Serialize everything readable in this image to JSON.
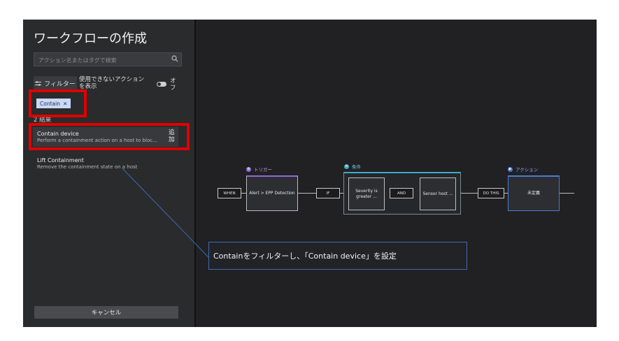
{
  "panel": {
    "title": "ワークフローの作成",
    "search_placeholder": "アクション名またはタグで検索",
    "filter_label": "フィルター",
    "unavailable_toggle_label": "使用できないアクションを表示",
    "toggle_state": "オフ",
    "chip_label": "Contain",
    "results_count": "2 結果",
    "results": [
      {
        "name": "Contain device",
        "description": "Perform a containment action on a host to bloc..."
      },
      {
        "name": "Lift Containment",
        "description": "Remove the containment state on a host"
      }
    ],
    "add_label": "追加",
    "cancel_label": "キャンセル"
  },
  "diagram": {
    "trigger_header": "トリガー",
    "condition_header": "条件",
    "action_header": "アクション",
    "when_label": "WHEN",
    "trigger_node": "Alert > EPP Detection",
    "if_label": "IF",
    "condition1": "Severity is greater ...",
    "and_label": "AND",
    "condition2": "Sensor host ...",
    "do_this_label": "DO THIS",
    "action_node": "未定義"
  },
  "annotation": {
    "callout_text": "Containをフィルターし、「Contain device」を設定"
  },
  "colors": {
    "trigger_accent": "#8e6ad8",
    "condition_accent": "#3fa9c9",
    "action_accent": "#4a7bd0",
    "highlight": "#e00000",
    "chip_bg": "#c9d9f7"
  }
}
